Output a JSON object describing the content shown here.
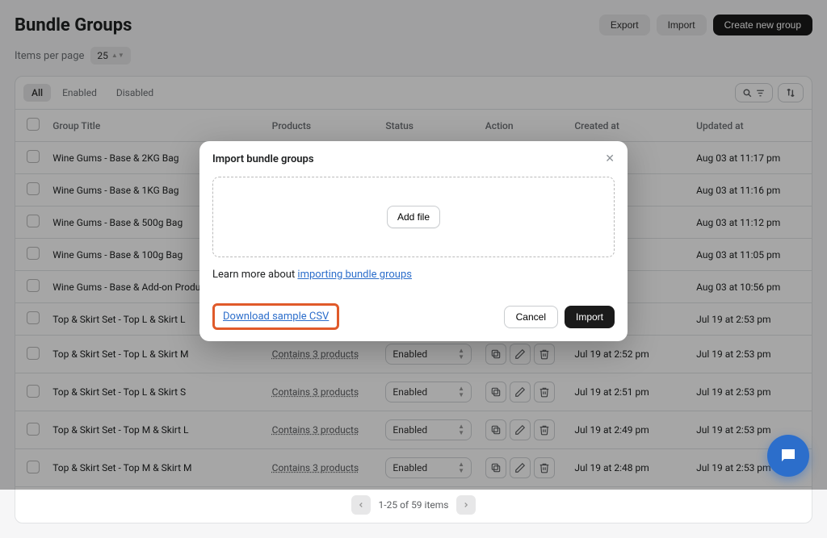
{
  "header": {
    "title": "Bundle Groups",
    "export_label": "Export",
    "import_label": "Import",
    "create_label": "Create new group"
  },
  "items_per_page": {
    "label": "Items per page",
    "value": "25"
  },
  "tabs": {
    "all": "All",
    "enabled": "Enabled",
    "disabled": "Disabled"
  },
  "columns": {
    "title": "Group Title",
    "products": "Products",
    "status": "Status",
    "action": "Action",
    "created": "Created at",
    "updated": "Updated at"
  },
  "rows": [
    {
      "title": "Wine Gums - Base & 2KG Bag",
      "products": "",
      "status": "",
      "created": "17 pm",
      "updated": "Aug 03 at 11:17 pm"
    },
    {
      "title": "Wine Gums - Base & 1KG Bag",
      "products": "",
      "status": "",
      "created": "16 pm",
      "updated": "Aug 03 at 11:16 pm"
    },
    {
      "title": "Wine Gums - Base & 500g Bag",
      "products": "",
      "status": "",
      "created": "12 pm",
      "updated": "Aug 03 at 11:12 pm"
    },
    {
      "title": "Wine Gums - Base & 100g Bag",
      "products": "",
      "status": "",
      "created": "05 pm",
      "updated": "Aug 03 at 11:05 pm"
    },
    {
      "title": "Wine Gums - Base & Add-on Products",
      "products": "",
      "status": "",
      "created": "56 pm",
      "updated": "Aug 03 at 10:56 pm"
    },
    {
      "title": "Top & Skirt Set - Top L & Skirt L",
      "products": "",
      "status": "",
      "created": "pm",
      "updated": "Jul 19 at 2:53 pm"
    },
    {
      "title": "Top & Skirt Set - Top L & Skirt M",
      "products": "Contains 3 products",
      "status": "Enabled",
      "created": "Jul 19 at 2:52 pm",
      "updated": "Jul 19 at 2:53 pm"
    },
    {
      "title": "Top & Skirt Set - Top L & Skirt S",
      "products": "Contains 3 products",
      "status": "Enabled",
      "created": "Jul 19 at 2:51 pm",
      "updated": "Jul 19 at 2:53 pm"
    },
    {
      "title": "Top & Skirt Set - Top M & Skirt L",
      "products": "Contains 3 products",
      "status": "Enabled",
      "created": "Jul 19 at 2:49 pm",
      "updated": "Jul 19 at 2:53 pm"
    },
    {
      "title": "Top & Skirt Set - Top M & Skirt M",
      "products": "Contains 3 products",
      "status": "Enabled",
      "created": "Jul 19 at 2:48 pm",
      "updated": "Jul 19 at 2:53 pm"
    }
  ],
  "pagination": {
    "summary": "1-25 of 59 items"
  },
  "modal": {
    "title": "Import bundle groups",
    "addfile_label": "Add file",
    "learn_prefix": "Learn more about ",
    "learn_link": "importing bundle groups",
    "download_label": "Download sample CSV",
    "cancel_label": "Cancel",
    "import_label": "Import"
  }
}
